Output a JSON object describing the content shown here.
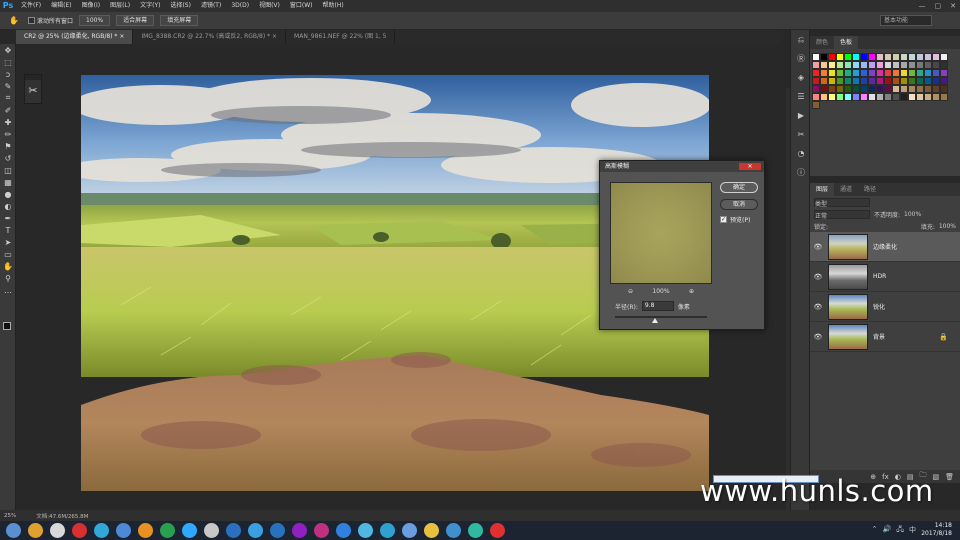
{
  "app": {
    "logo": "Ps",
    "menus": [
      "文件(F)",
      "编辑(E)",
      "图像(I)",
      "图层(L)",
      "文字(Y)",
      "选择(S)",
      "滤镜(T)",
      "3D(D)",
      "视图(V)",
      "窗口(W)",
      "帮助(H)"
    ],
    "window_controls": [
      "—",
      "▢",
      "✕"
    ]
  },
  "options_bar": {
    "checkbox_label": "滚动所有窗口",
    "zoom_value": "100%",
    "fit_screen": "适合屏幕",
    "fill_screen": "填充屏幕",
    "workspace": "基本功能"
  },
  "tabs": [
    {
      "label": "CR2 @ 25% (边缘柔化, RGB/8) *  ×",
      "active": true
    },
    {
      "label": "IMG_8388.CR2 @ 22.7% (高或反2, RGB/8) *  ×",
      "active": false
    },
    {
      "label": "MAN_9861.NEF @ 22% (图 1, 5",
      "active": false
    }
  ],
  "toolbar": {
    "icons": [
      "move-icon",
      "marquee-icon",
      "lasso-icon",
      "quick-select-icon",
      "crop-icon",
      "eyedropper-icon",
      "healing-icon",
      "brush-icon",
      "stamp-icon",
      "history-brush-icon",
      "eraser-icon",
      "gradient-icon",
      "blur-icon",
      "dodge-icon",
      "pen-icon",
      "type-icon",
      "path-select-icon",
      "shape-icon",
      "hand-icon",
      "zoom-icon",
      "more-icon"
    ],
    "glyphs": [
      "✥",
      "⬚",
      "ↄ",
      "✎",
      "⌗",
      "✐",
      "✚",
      "✏",
      "⚑",
      "↺",
      "◫",
      "▦",
      "●",
      "◐",
      "✒",
      "T",
      "➤",
      "▭",
      "✋",
      "⚲",
      "…"
    ]
  },
  "dialog": {
    "title": "高斯模糊",
    "close": "✕",
    "ok": "确定",
    "cancel": "取消",
    "preview_label": "预览(P)",
    "preview_checked": "✓",
    "zoom_out": "⊖",
    "zoom": "100%",
    "zoom_in": "⊕",
    "radius_label": "半径(R):",
    "radius_value": "9.8",
    "radius_unit": "像素",
    "slider_position": 0.44
  },
  "status": {
    "zoom": "25%",
    "doc": "文档:47.6M/265.8M"
  },
  "swatches_panel": {
    "tabs": [
      "颜色",
      "色板"
    ],
    "active_tab": 1,
    "colors": [
      "#ffffff",
      "#000000",
      "#ff0000",
      "#ffff00",
      "#00ff00",
      "#00ffff",
      "#0000ff",
      "#ff00ff",
      "#e0c0c0",
      "#d8c8b0",
      "#d0d0a8",
      "#c8d8c0",
      "#c0d8d8",
      "#c0c8e0",
      "#d0c0e0",
      "#e0c0d8",
      "#f0f0f0",
      "#f0a0a0",
      "#f4c890",
      "#f8f090",
      "#b8e890",
      "#90e0b8",
      "#90d8f0",
      "#a0b8f0",
      "#c0a0f0",
      "#f0a0d8",
      "#d8d8d8",
      "#c0c0c0",
      "#a8a8a8",
      "#909090",
      "#787878",
      "#606060",
      "#484848",
      "#303030",
      "#ee2222",
      "#f08030",
      "#f0e020",
      "#60c030",
      "#20b080",
      "#20a0d8",
      "#3060d8",
      "#8040c8",
      "#d830a0",
      "#e04040",
      "#e87838",
      "#e8d830",
      "#70b840",
      "#30a888",
      "#2890c8",
      "#4858c0",
      "#8840b8",
      "#c81818",
      "#d06818",
      "#c8b808",
      "#489828",
      "#108868",
      "#1078b0",
      "#2040a8",
      "#6028a0",
      "#b01880",
      "#a01010",
      "#a85010",
      "#a09000",
      "#387818",
      "#086850",
      "#085890",
      "#183088",
      "#481880",
      "#881060",
      "#701010",
      "#804010",
      "#786800",
      "#285810",
      "#045038",
      "#044068",
      "#102460",
      "#341060",
      "#600c40",
      "#d8b898",
      "#c0a078",
      "#a88860",
      "#907048",
      "#785838",
      "#604028",
      "#4c3020",
      "#ff8080",
      "#ffc080",
      "#ffff80",
      "#80ff80",
      "#80ffff",
      "#8080ff",
      "#ff80ff",
      "#e0e0e0",
      "#b0b0b0",
      "#808080",
      "#505050",
      "#202020",
      "#f8e0c0",
      "#e0c8a0",
      "#c8b080",
      "#b09060",
      "#987848",
      "#806030"
    ],
    "icons": [
      "new-swatch-icon",
      "delete-icon"
    ]
  },
  "layers_panel": {
    "tabs": [
      "图层",
      "通道",
      "路径"
    ],
    "active_tab": 0,
    "filter": "类型",
    "blend": "正常",
    "opacity_label": "不透明度:",
    "opacity": "100%",
    "lock_label": "锁定:",
    "fill_label": "填充:",
    "fill": "100%",
    "layers": [
      {
        "name": "边缘柔化",
        "selected": true,
        "thumb": "golden",
        "visible": "👁",
        "lock": ""
      },
      {
        "name": "HDR",
        "selected": false,
        "thumb": "gray",
        "visible": "👁",
        "lock": ""
      },
      {
        "name": "锐化",
        "selected": false,
        "thumb": "landscape",
        "visible": "👁",
        "lock": ""
      },
      {
        "name": "背景",
        "selected": false,
        "thumb": "landscape",
        "visible": "👁",
        "lock": "🔒"
      }
    ],
    "foot_icons": [
      "⊕",
      "fx",
      "◐",
      "▤",
      "🗀",
      "▧",
      "🗑"
    ]
  },
  "taskbar": {
    "time": "14:18",
    "date": "2017/8/18",
    "tray": [
      "⌃",
      "🔊",
      "🖧",
      "中"
    ],
    "apps": [
      "#5b8fd0",
      "#e0a030",
      "#d8d8d8",
      "#d83030",
      "#30a8d8",
      "#4c8ad8",
      "#e89020",
      "#28a050",
      "#31a8ff",
      "#c8c8c8",
      "#2a70c0",
      "#3aa0e0",
      "#2870c0",
      "#9020c0",
      "#c03080",
      "#3080e0",
      "#50b8e0",
      "#30a0d0",
      "#6a9ee0",
      "#e8c040",
      "#4090d0",
      "#30b8a0",
      "#e03030"
    ]
  },
  "watermark": "www.hunls.com",
  "strip_icons": [
    "history-icon",
    "ra-icon",
    "3d-icon",
    "properties-icon",
    "actions-icon",
    "tools-icon",
    "adjust-icon",
    "info-icon"
  ]
}
